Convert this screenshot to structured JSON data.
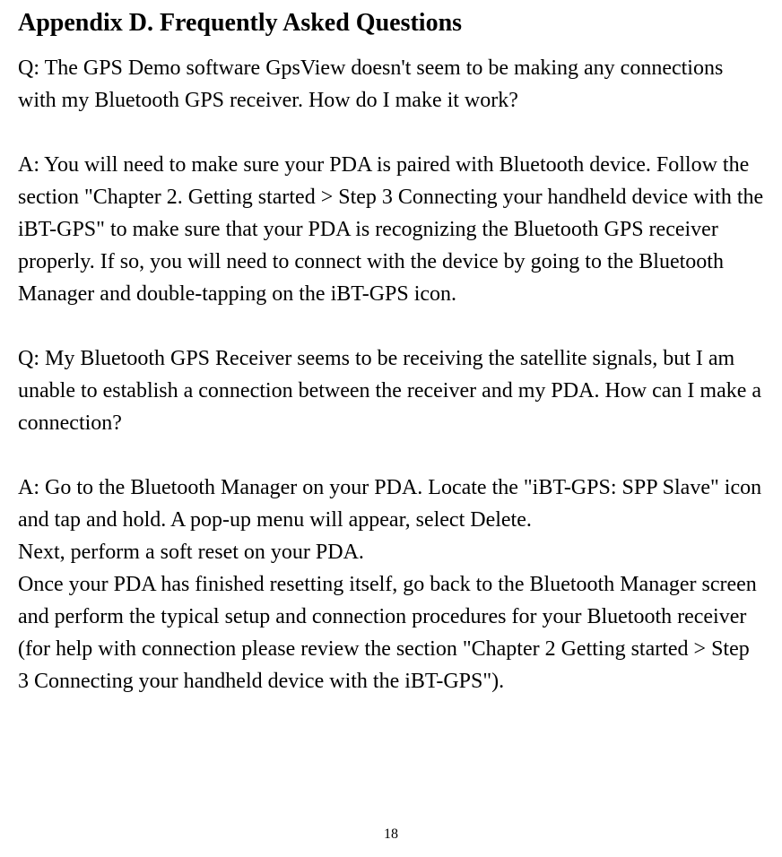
{
  "heading": "Appendix D. Frequently Asked Questions",
  "faq": {
    "q1": "Q: The GPS Demo software GpsView doesn't seem to be making any connections with my Bluetooth GPS receiver. How do I make it work?",
    "a1": "A: You will need to make sure your PDA is paired with Bluetooth device. Follow the section \"Chapter 2. Getting started > Step 3 Connecting your handheld device with the iBT-GPS\" to make sure that your PDA is recognizing the Bluetooth GPS receiver properly. If so, you will need to connect with the device by going to the Bluetooth Manager and double-tapping on the iBT-GPS icon.",
    "q2": "Q: My Bluetooth GPS Receiver seems to be receiving the satellite signals, but I am unable to establish a connection between the receiver and my PDA. How can I make a connection?",
    "a2_p1": "A: Go to the Bluetooth Manager on your PDA. Locate the \"iBT-GPS: SPP Slave\" icon and tap and hold. A pop-up menu will appear, select Delete.",
    "a2_p2": "Next, perform a soft reset on your PDA.",
    "a2_p3": "Once your PDA has finished resetting itself, go back to the Bluetooth Manager screen and perform the typical setup and connection procedures for your Bluetooth receiver (for help with connection please review the section \"Chapter 2 Getting started > Step 3 Connecting your handheld device with the iBT-GPS\")."
  },
  "page_number": "18"
}
